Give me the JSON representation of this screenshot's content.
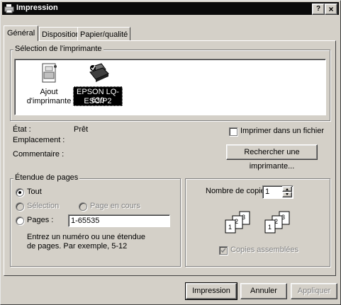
{
  "window": {
    "title": "Impression",
    "help_label": "?",
    "close_label": "×"
  },
  "tabs": [
    {
      "label": "Général"
    },
    {
      "label": "Disposition"
    },
    {
      "label": "Papier/qualité"
    }
  ],
  "printer_selection": {
    "legend": "Sélection de l'imprimante",
    "add_printer_line1": "Ajout",
    "add_printer_line2": "d'imprimante",
    "printer_line1": "EPSON LQ-630",
    "printer_line2": "ESC/P2"
  },
  "status": {
    "state_label": "État :",
    "state_value": "Prêt",
    "location_label": "Emplacement :",
    "comment_label": "Commentaire :",
    "print_to_file_label": "Imprimer dans un fichier",
    "find_printer_label": "Rechercher une imprimante..."
  },
  "page_range": {
    "legend": "Étendue de pages",
    "all_label": "Tout",
    "selection_label": "Sélection",
    "current_page_label": "Page en cours",
    "pages_label": "Pages :",
    "pages_value": "1-65535",
    "hint": "Entrez un numéro ou une étendue de pages. Par exemple, 5-12"
  },
  "copies": {
    "count_label": "Nombre de copies :",
    "count_value": "1",
    "collate_label": "Copies assemblées"
  },
  "buttons": {
    "print": "Impression",
    "cancel": "Annuler",
    "apply": "Appliquer"
  },
  "colors": {
    "title_bar": "#0a0a0a",
    "face": "#d4d0c8",
    "selected": "#000000"
  }
}
